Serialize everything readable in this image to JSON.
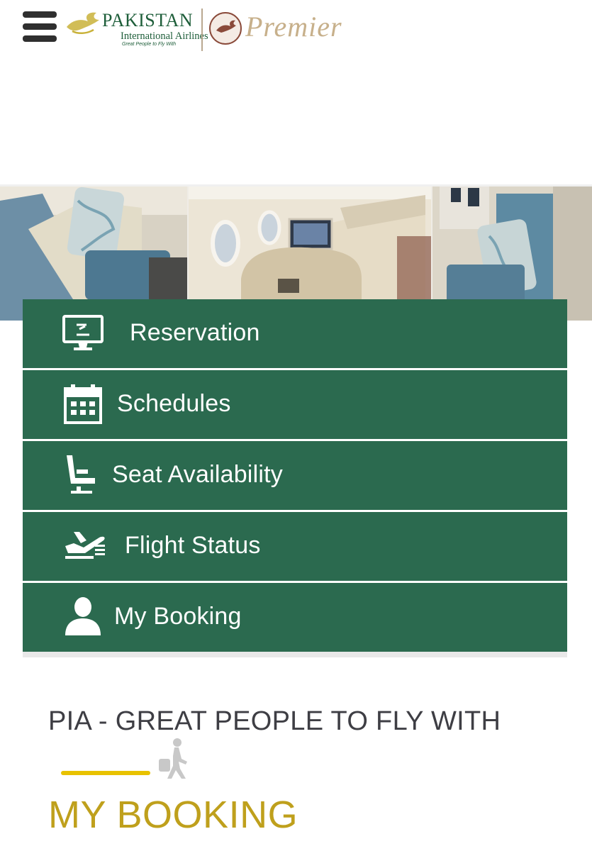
{
  "header": {
    "menu_icon": "hamburger-menu-icon",
    "brand_name": "PAKISTAN",
    "brand_subtitle": "International Airlines",
    "brand_tagline": "Great People to Fly With",
    "premier_label": "Premier",
    "colors": {
      "brand_green": "#1e5e3a",
      "premier_gold": "#c7b08b"
    }
  },
  "banner": {
    "image": "business-class-cabin-seats"
  },
  "menu": {
    "color": "#2b6a4f",
    "items": [
      {
        "label": "Reservation",
        "icon": "monitor-reservation-icon"
      },
      {
        "label": "Schedules",
        "icon": "calendar-icon"
      },
      {
        "label": "Seat Availability",
        "icon": "seat-icon"
      },
      {
        "label": "Flight Status",
        "icon": "plane-departure-icon"
      },
      {
        "label": "My Booking",
        "icon": "user-icon"
      }
    ]
  },
  "tagline": "PIA - GREAT PEOPLE TO FLY WITH",
  "section": {
    "title": "MY BOOKING",
    "accent_color": "#e8c200",
    "title_color": "#bfa01c",
    "icon": "walking-traveler-icon"
  }
}
